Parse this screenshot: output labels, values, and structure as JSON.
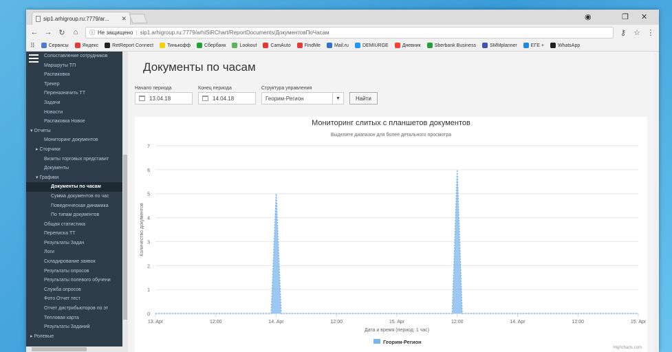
{
  "browser": {
    "tab_title": "sip1.arhigroup.ru:7779/ar...",
    "security": "Не защищено",
    "url": "sip1.arhigroup.ru:7779/arhiSiRChart/ReportDocuments/ДокументовПоЧасам",
    "bookmarks": [
      {
        "label": "Сервисы",
        "color": "#4a7bd1"
      },
      {
        "label": "Яндекс",
        "color": "#e53935"
      },
      {
        "label": "RetReport Connect",
        "color": "#222222"
      },
      {
        "label": "Тинькофф",
        "color": "#f5d10a"
      },
      {
        "label": "Сбербанк",
        "color": "#21a038"
      },
      {
        "label": "Lookout",
        "color": "#5ab55e"
      },
      {
        "label": "CamAuto",
        "color": "#e53935"
      },
      {
        "label": "FindMe",
        "color": "#e53935"
      },
      {
        "label": "Mail.ru",
        "color": "#2f6fd6"
      },
      {
        "label": "DEMIURGE",
        "color": "#2196f3"
      },
      {
        "label": "Дневник",
        "color": "#f44336"
      },
      {
        "label": "Sberbank Business",
        "color": "#21a038"
      },
      {
        "label": "SMMplanner",
        "color": "#3f51b5"
      },
      {
        "label": "ЕГЕ +",
        "color": "#1e88e5"
      },
      {
        "label": "WhatsApp",
        "color": "#222222"
      }
    ]
  },
  "sidebar": {
    "items": [
      {
        "label": "Сопоставление сотрудников",
        "level": 2
      },
      {
        "label": "Маршруты ТП",
        "level": 2
      },
      {
        "label": "Распаковка",
        "level": 2
      },
      {
        "label": "Трекер",
        "level": 2
      },
      {
        "label": "Переназначить ТТ",
        "level": 2
      },
      {
        "label": "Задачи",
        "level": 2
      },
      {
        "label": "Новости",
        "level": 2
      },
      {
        "label": "Распаковка Новое",
        "level": 2
      },
      {
        "label": "▾ Отчеты",
        "level": 0
      },
      {
        "label": "Мониторинг документов",
        "level": 2
      },
      {
        "label": "▸ Сторчики",
        "level": 1
      },
      {
        "label": "Визиты торговых представит",
        "level": 2
      },
      {
        "label": "Документы",
        "level": 2
      },
      {
        "label": "▾ Графики",
        "level": 1
      },
      {
        "label": "Документы по часам",
        "level": 3,
        "active": true
      },
      {
        "label": "Сумма документов по час",
        "level": 3
      },
      {
        "label": "Поведенческая динамика",
        "level": 3
      },
      {
        "label": "По типам документов",
        "level": 3
      },
      {
        "label": "Общая статистика",
        "level": 2
      },
      {
        "label": "Переписка ТТ",
        "level": 2
      },
      {
        "label": "Результаты Задач",
        "level": 2
      },
      {
        "label": "Логи",
        "level": 2
      },
      {
        "label": "Складирование заявок",
        "level": 2
      },
      {
        "label": "Результаты опросов",
        "level": 2
      },
      {
        "label": "Результаты полевого обучени",
        "level": 2
      },
      {
        "label": "Служба опросов",
        "level": 2
      },
      {
        "label": "Фото Отчет тест",
        "level": 2
      },
      {
        "label": "Отчет дистрибьюторов по эт",
        "level": 2
      },
      {
        "label": "Тепловая карта",
        "level": 2
      },
      {
        "label": "Результаты Заданий",
        "level": 2
      },
      {
        "label": "▸ Ролевые",
        "level": 0
      }
    ]
  },
  "page": {
    "title": "Документы по часам",
    "start_label": "Начало периода",
    "start_value": "13.04.18",
    "end_label": "Конец периода",
    "end_value": "14.04.18",
    "struct_label": "Структура управления",
    "struct_value": "Георим-Регион",
    "find_button": "Найти"
  },
  "chart_data": {
    "type": "area",
    "title": "Мониторинг слитых с планшетов документов",
    "subtitle": "Выделите диапазон для более детального просмотра",
    "xlabel": "Дата и время (период: 1 час)",
    "ylabel": "Количество документов",
    "ylim": [
      0,
      7
    ],
    "yticks": [
      0,
      1,
      2,
      3,
      4,
      5,
      6,
      7
    ],
    "xticks": [
      "13. Apr",
      "12:00",
      "14. Apr",
      "12:00",
      "15. Apr",
      "12:00",
      "14. Apr",
      "12:00",
      "15. Apr"
    ],
    "x_hours_per_tick": 12,
    "series": [
      {
        "name": "Георим-Регион",
        "color": "#7cb5ec",
        "points": [
          [
            0,
            0
          ],
          [
            23,
            0
          ],
          [
            24,
            5
          ],
          [
            25,
            0
          ],
          [
            59,
            0
          ],
          [
            60,
            6
          ],
          [
            61,
            0
          ],
          [
            96,
            0
          ]
        ]
      }
    ],
    "legend_position": "bottom-center",
    "credit": "Highcharts.com"
  }
}
